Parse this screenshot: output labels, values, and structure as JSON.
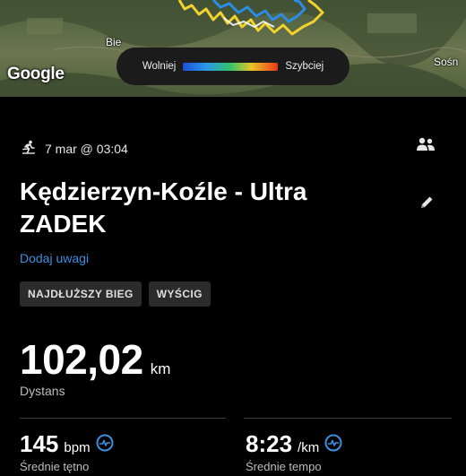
{
  "map": {
    "place_left": "Bie",
    "place_right": "Sośn",
    "google_logo": "Google",
    "legend_slow": "Wolniej",
    "legend_fast": "Szybciej",
    "track_colors": [
      "#f2d22e",
      "#2a8de6",
      "#ffffff",
      "#e6c525"
    ]
  },
  "activity": {
    "activity_icon": "running-icon",
    "datetime": "7 mar @ 03:04",
    "title": "Kędzierzyn-Koźle - Ultra ZADEK",
    "add_note": "Dodaj uwagi",
    "tags": [
      "NAJDŁUŻSZY BIEG",
      "WYŚCIG"
    ],
    "accent_color": "#3d8fe0"
  },
  "distance": {
    "value": "102,02",
    "unit": "km",
    "label": "Dystans"
  },
  "stats": {
    "heart_rate": {
      "value": "145",
      "unit": "bpm",
      "label": "Średnie tętno"
    },
    "pace": {
      "value": "8:23",
      "unit": "/km",
      "label": "Średnie tempo"
    }
  }
}
